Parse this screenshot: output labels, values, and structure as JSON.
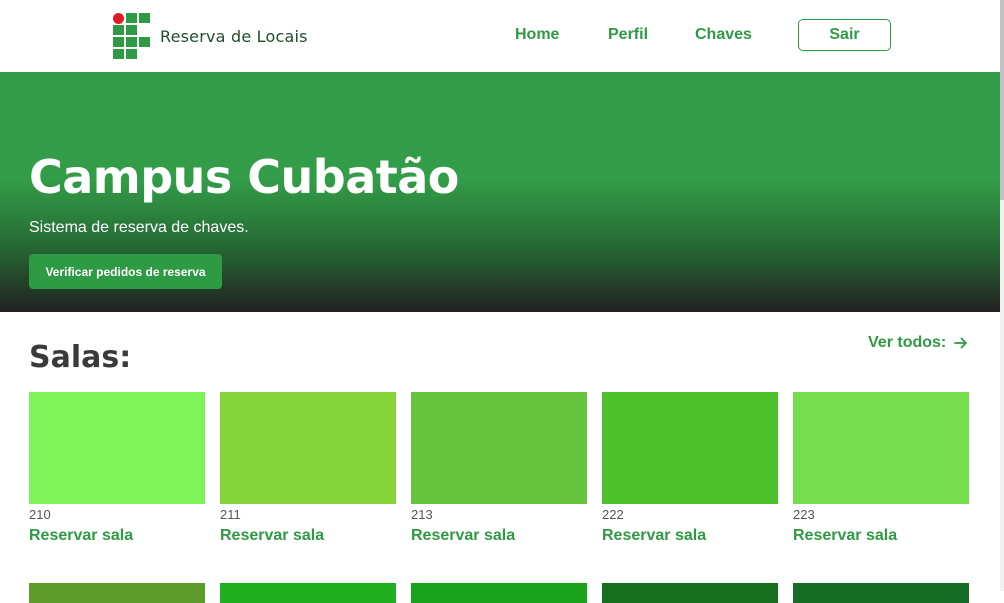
{
  "header": {
    "brand": "Reserva de Locais",
    "nav": [
      "Home",
      "Perfil",
      "Chaves"
    ],
    "logout": "Sair"
  },
  "hero": {
    "title": "Campus Cubatão",
    "subtitle": "Sistema de reserva de chaves.",
    "button": "Verificar pedidos de reserva"
  },
  "rooms": {
    "title": "Salas:",
    "see_all": "Ver todos:",
    "see_all_icon": "arrow-right-icon",
    "items": [
      {
        "number": "210",
        "action": "Reservar sala",
        "color": "#80f25a"
      },
      {
        "number": "211",
        "action": "Reservar sala",
        "color": "#86d53b"
      },
      {
        "number": "213",
        "action": "Reservar sala",
        "color": "#66c43e"
      },
      {
        "number": "222",
        "action": "Reservar sala",
        "color": "#4fc12d"
      },
      {
        "number": "223",
        "action": "Reservar sala",
        "color": "#76dd4f"
      }
    ],
    "next_row_colors": [
      "#5e9a2c",
      "#1fae20",
      "#19a31c",
      "#166f1f",
      "#156d23"
    ]
  },
  "colors": {
    "primary": "#2f9a44",
    "hero_top": "#339c48",
    "hero_bottom": "#212121",
    "logo_red": "#e01a22",
    "logo_green": "#2f9a44"
  }
}
